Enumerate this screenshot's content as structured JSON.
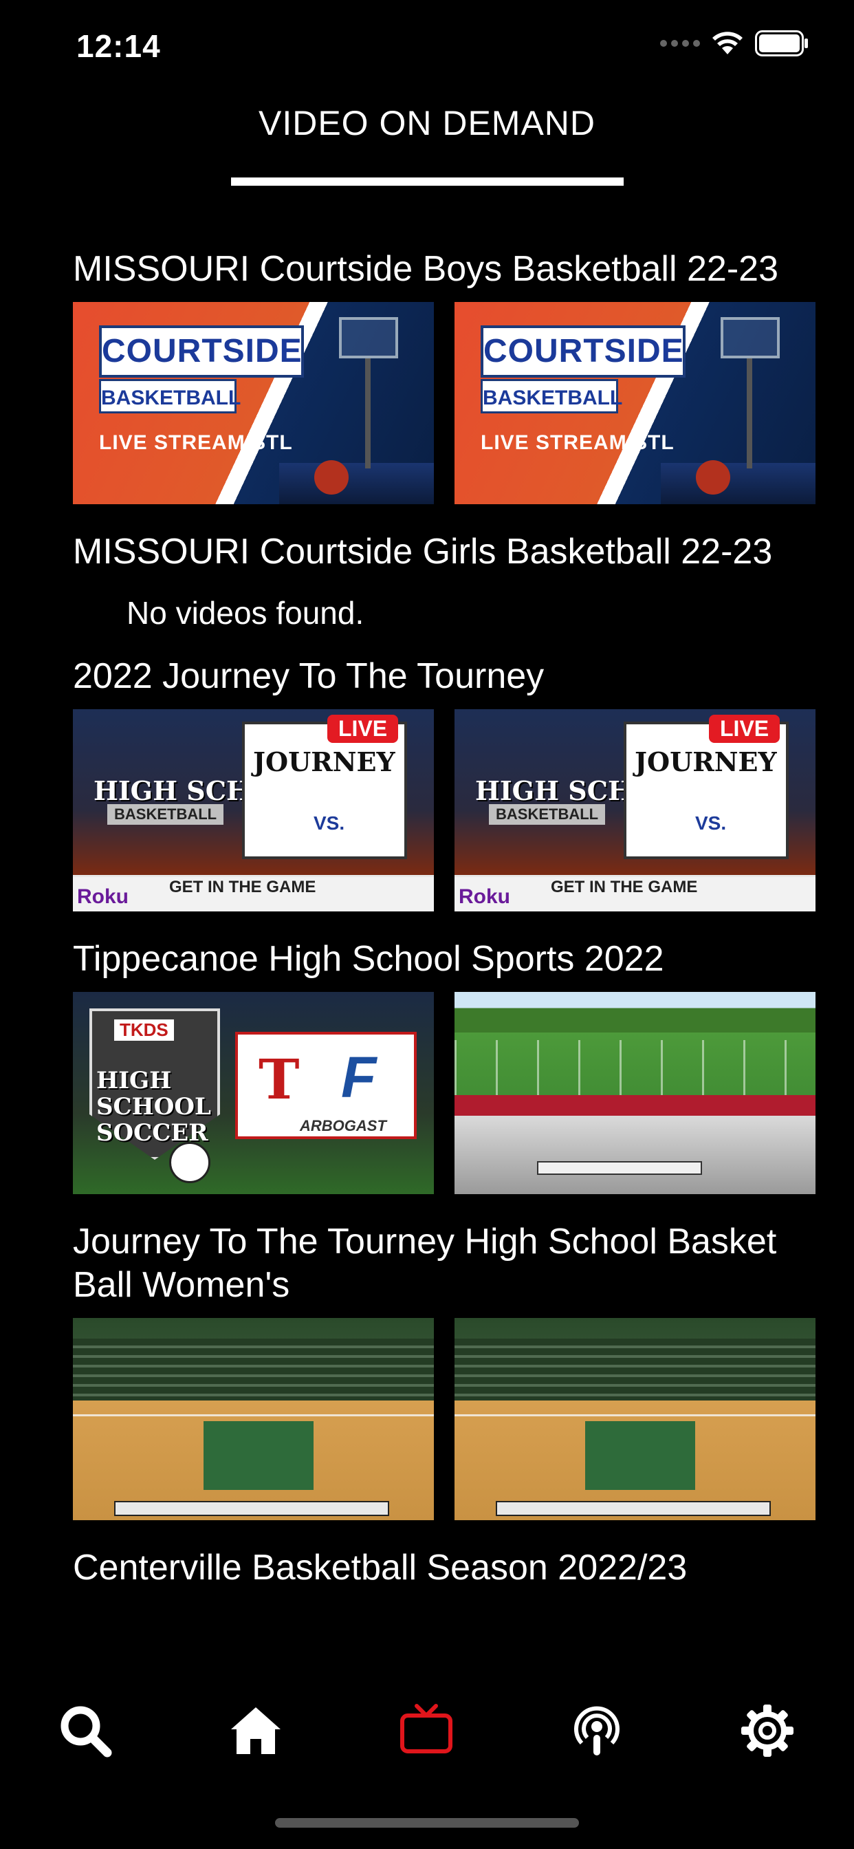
{
  "status_bar": {
    "time": "12:14"
  },
  "header": {
    "title": "VIDEO ON DEMAND"
  },
  "sections": [
    {
      "title": "MISSOURI Courtside Boys Basketball 22-23",
      "empty_message": ""
    },
    {
      "title": "MISSOURI Courtside Girls Basketball 22-23",
      "empty_message": "No videos found."
    },
    {
      "title": "2022 Journey To The Tourney",
      "empty_message": ""
    },
    {
      "title": "Tippecanoe High School Sports 2022",
      "empty_message": ""
    },
    {
      "title": "Journey To The Tourney High School Basket Ball Women's",
      "empty_message": ""
    },
    {
      "title": "Centerville Basketball Season 2022/23",
      "empty_message": ""
    }
  ],
  "thumbs": {
    "courtside": {
      "title": "COURTSIDE",
      "subtitle": "BASKETBALL",
      "footer": "LIVE STREAM STL"
    },
    "tkds": {
      "hs": "HIGH SCHOOL",
      "bb": "BASKETBALL",
      "live": "LIVE",
      "journey": "JOURNEY",
      "vs": "VS.",
      "banner": "GET IN THE GAME",
      "roku": "Roku"
    },
    "soccer": {
      "tk": "TKDS",
      "hs": "HIGH SCHOOL SOCCER",
      "t": "T",
      "f": "F",
      "arb": "ARBOGAST"
    }
  },
  "tabbar": {
    "items": [
      {
        "icon": "search-icon",
        "active": false
      },
      {
        "icon": "home-icon",
        "active": false
      },
      {
        "icon": "tv-icon",
        "active": true
      },
      {
        "icon": "podcast-icon",
        "active": false
      },
      {
        "icon": "gear-icon",
        "active": false
      }
    ],
    "active_color": "#e0151b",
    "inactive_color": "#ffffff"
  }
}
